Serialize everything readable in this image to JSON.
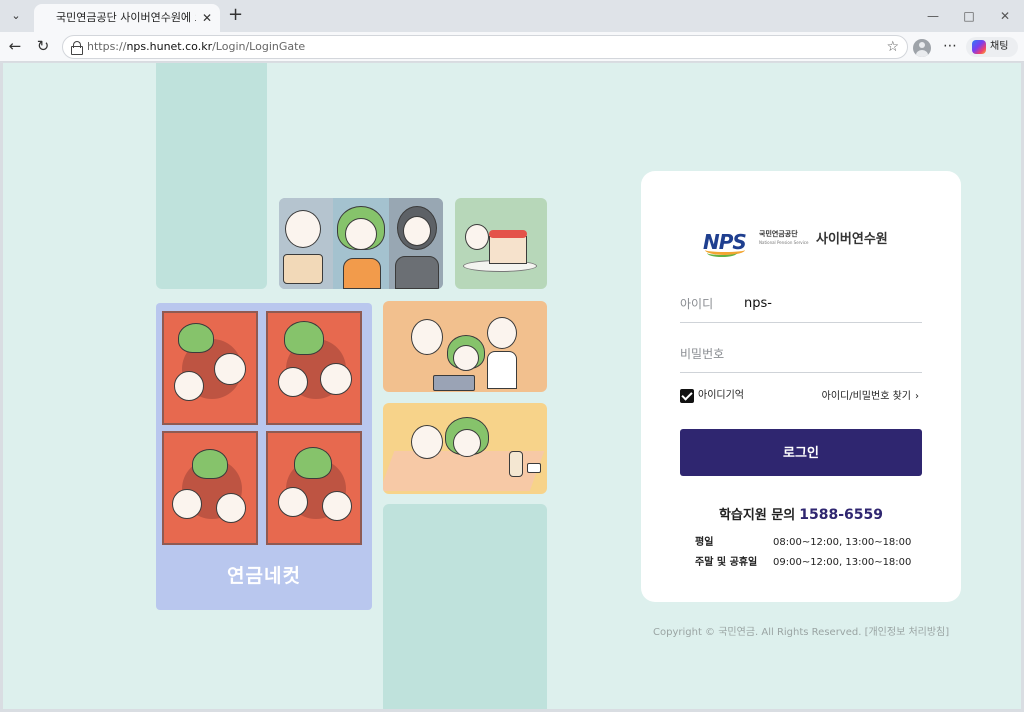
{
  "browser": {
    "tab_title": "국민연금공단 사이버연수원에 오신 것을 환영합니다",
    "url_scheme": "https://",
    "url_host": "nps.hunet.co.kr",
    "url_path": "/Login/LoginGate",
    "copilot_label": "채팅",
    "icons": [
      "tab-list-icon",
      "close-icon",
      "new-tab-icon",
      "minimize-icon",
      "maximize-icon",
      "window-close-icon",
      "back-icon",
      "reload-icon",
      "lock-icon",
      "star-icon",
      "profile-icon",
      "more-icon",
      "copilot-icon"
    ]
  },
  "illustration": {
    "four_cut_label": "연금네컷"
  },
  "login": {
    "logo_mark": "NPS",
    "logo_org": "국민연금공단",
    "logo_org_en": "National Pension Service",
    "logo_name": "사이버연수원",
    "id_label": "아이디",
    "id_value": "nps-",
    "password_label": "비밀번호",
    "remember_label": "아이디기억",
    "remember_checked": true,
    "find_link": "아이디/비밀번호 찾기",
    "login_button": "로그인"
  },
  "support": {
    "label": "학습지원 문의",
    "phone": "1588-6559",
    "hours": [
      {
        "day": "평일",
        "time": "08:00~12:00, 13:00~18:00"
      },
      {
        "day": "주말 및 공휴일",
        "time": "09:00~12:00, 13:00~18:00"
      }
    ]
  },
  "footer": {
    "copyright": "Copyright © 국민연금. All Rights Reserved. [개인정보 처리방침]"
  },
  "colors": {
    "background": "#ddf0ed",
    "accent": "#2f2670",
    "teal_block": "#bfe2dc",
    "four_cut_panel": "#b9c7ee"
  }
}
